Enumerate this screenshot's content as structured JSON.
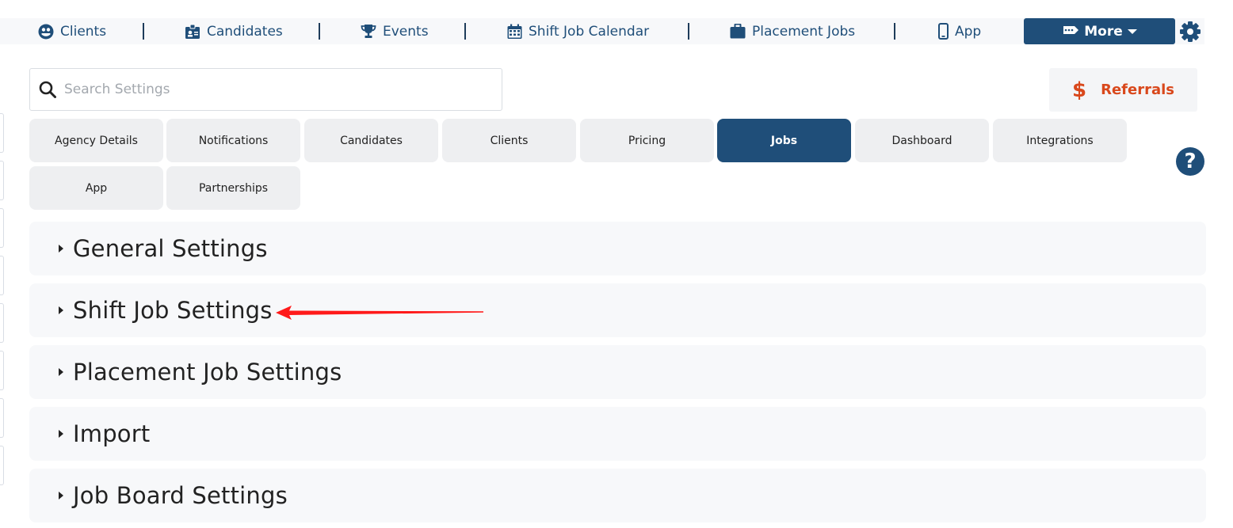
{
  "nav": {
    "items": [
      {
        "label": "Clients",
        "icon": "user-circle-icon"
      },
      {
        "label": "Candidates",
        "icon": "id-badge-icon"
      },
      {
        "label": "Events",
        "icon": "trophy-icon"
      },
      {
        "label": "Shift Job Calendar",
        "icon": "calendar-icon"
      },
      {
        "label": "Placement Jobs",
        "icon": "briefcase-icon"
      },
      {
        "label": "App",
        "icon": "mobile-icon"
      }
    ],
    "more_label": "More",
    "settings_icon": "gear-icon"
  },
  "search": {
    "placeholder": "Search Settings",
    "value": ""
  },
  "referrals": {
    "symbol": "$",
    "label": "Referrals"
  },
  "tabs": [
    {
      "label": "Agency Details",
      "active": false
    },
    {
      "label": "Notifications",
      "active": false
    },
    {
      "label": "Candidates",
      "active": false
    },
    {
      "label": "Clients",
      "active": false
    },
    {
      "label": "Pricing",
      "active": false
    },
    {
      "label": "Jobs",
      "active": true
    },
    {
      "label": "Dashboard",
      "active": false
    },
    {
      "label": "Integrations",
      "active": false
    },
    {
      "label": "App",
      "active": false
    },
    {
      "label": "Partnerships",
      "active": false
    }
  ],
  "help_symbol": "?",
  "sections": [
    {
      "label": "General Settings"
    },
    {
      "label": "Shift Job Settings"
    },
    {
      "label": "Placement Job Settings"
    },
    {
      "label": "Import"
    },
    {
      "label": "Job Board Settings"
    }
  ],
  "colors": {
    "primary": "#1f4e79",
    "referral": "#d9481c",
    "annotation_arrow": "#ff1a1a"
  }
}
